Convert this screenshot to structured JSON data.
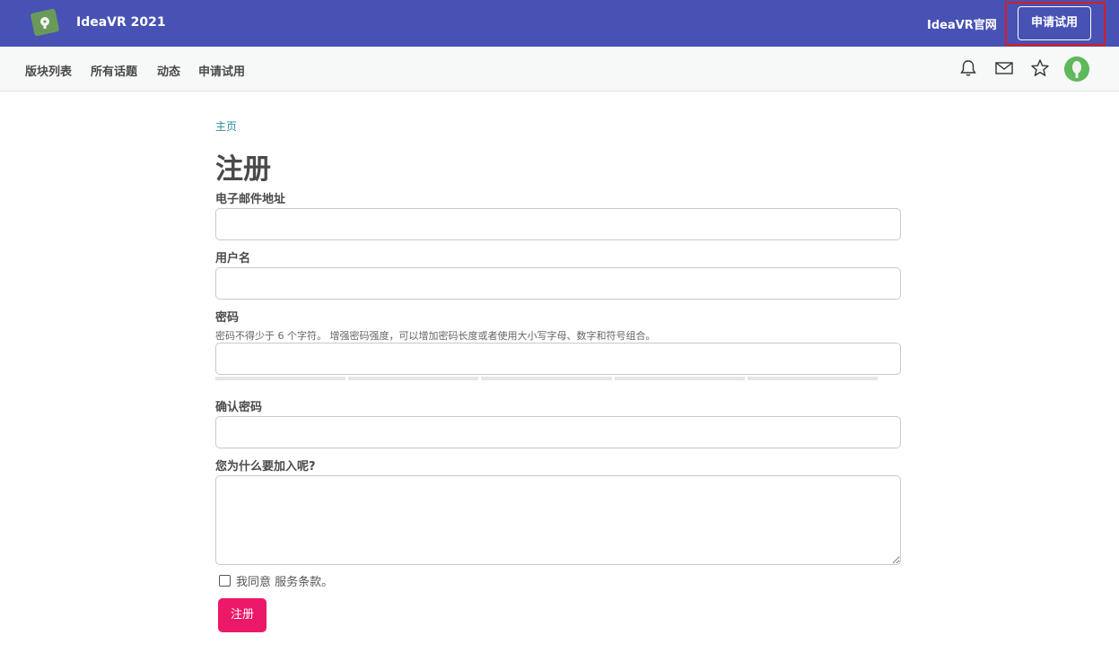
{
  "header": {
    "brand": "IdeaVR 2021",
    "site_link": "IdeaVR官网",
    "trial_button": "申请试用",
    "logo_icon": "lightbulb-logo-icon"
  },
  "nav": {
    "items": [
      {
        "label": "版块列表"
      },
      {
        "label": "所有话题"
      },
      {
        "label": "动态"
      },
      {
        "label": "申请试用"
      }
    ],
    "icons": [
      "bell-icon",
      "mail-icon",
      "star-icon",
      "avatar"
    ]
  },
  "breadcrumb": "主页",
  "page_title": "注册",
  "form": {
    "email_label": "电子邮件地址",
    "email_value": "",
    "username_label": "用户名",
    "username_value": "",
    "password_label": "密码",
    "password_hint": "密码不得少于 6 个字符。 增强密码强度，可以增加密码长度或者使用大小写字母、数字和符号组合。",
    "password_value": "",
    "password_strength_segments": 5,
    "confirm_label": "确认密码",
    "confirm_value": "",
    "reason_label": "您为什么要加入呢?",
    "reason_value": "",
    "agree_checked": false,
    "agree_text": "我同意 服务条款。",
    "submit_label": "注册"
  },
  "colors": {
    "topbar": "#4752b4",
    "submit": "#ec1968",
    "link": "#2e8aa6",
    "highlight": "#e0191e"
  }
}
